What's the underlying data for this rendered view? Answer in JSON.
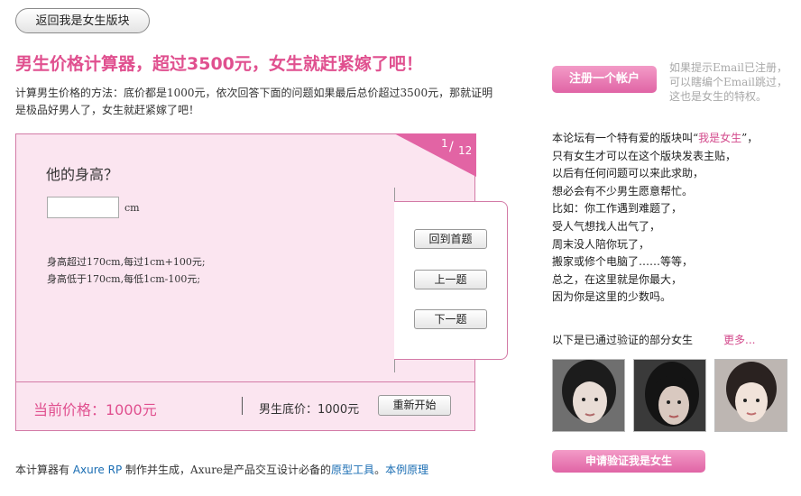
{
  "header": {
    "back_label": "返回我是女生版块"
  },
  "calculator": {
    "title": "男生价格计算器，超过3500元，女生就赶紧嫁了吧！",
    "intro": "计算男生价格的方法：底价都是1000元，依次回答下面的问题如果最后总价超过3500元，那就证明是极品好男人了，女生就赶紧嫁了吧！",
    "page_current": "1",
    "page_separator": "/",
    "page_total": "12",
    "question": "他的身高？",
    "height_value": "",
    "unit": "cm",
    "rules": [
      "身高超过170cm,每过1cm+100元;",
      "身高低于170cm,每低1cm-100元;"
    ],
    "nav_buttons": [
      "回到首题",
      "上一题",
      "下一题"
    ],
    "current_price": "当前价格：1000元",
    "base_price": "男生底价：1000元",
    "restart_label": "重新开始"
  },
  "footer": {
    "prefix": "本计算器有",
    "tool_name": "Axure RP",
    "middle": "制作并生成，Axure是产品交互设计必备的",
    "link1": "原型工具",
    "period": "。",
    "link2": "本例原理"
  },
  "sidebar": {
    "register_label": "注册一个帐户",
    "register_hint": "如果提示Email已注册，可以瞎编个Email跳过，这也是女生的特权。",
    "desc_lead": "本论坛有一个特有爱的版块叫“",
    "desc_highlight": "我是女生",
    "desc_close": "”，",
    "desc_lines": [
      "只有女生才可以在这个版块发表主贴，",
      "以后有任何问题可以来此求助，",
      "想必会有不少男生愿意帮忙。",
      "比如：你工作遇到难题了，",
      "受人气想找人出气了，",
      "周末没人陪你玩了，",
      "搬家或修个电脑了……等等，",
      "总之，在这里就是你最大，",
      "因为你是这里的少数吗。"
    ],
    "verified_label": "以下是已通过验证的部分女生",
    "more_label": "更多...",
    "apply_label": "申请验证我是女生"
  },
  "colors": {
    "accent": "#e0508f",
    "card_bg": "#fbe5f0",
    "card_border": "#d37aa6",
    "link": "#1a6db3"
  }
}
